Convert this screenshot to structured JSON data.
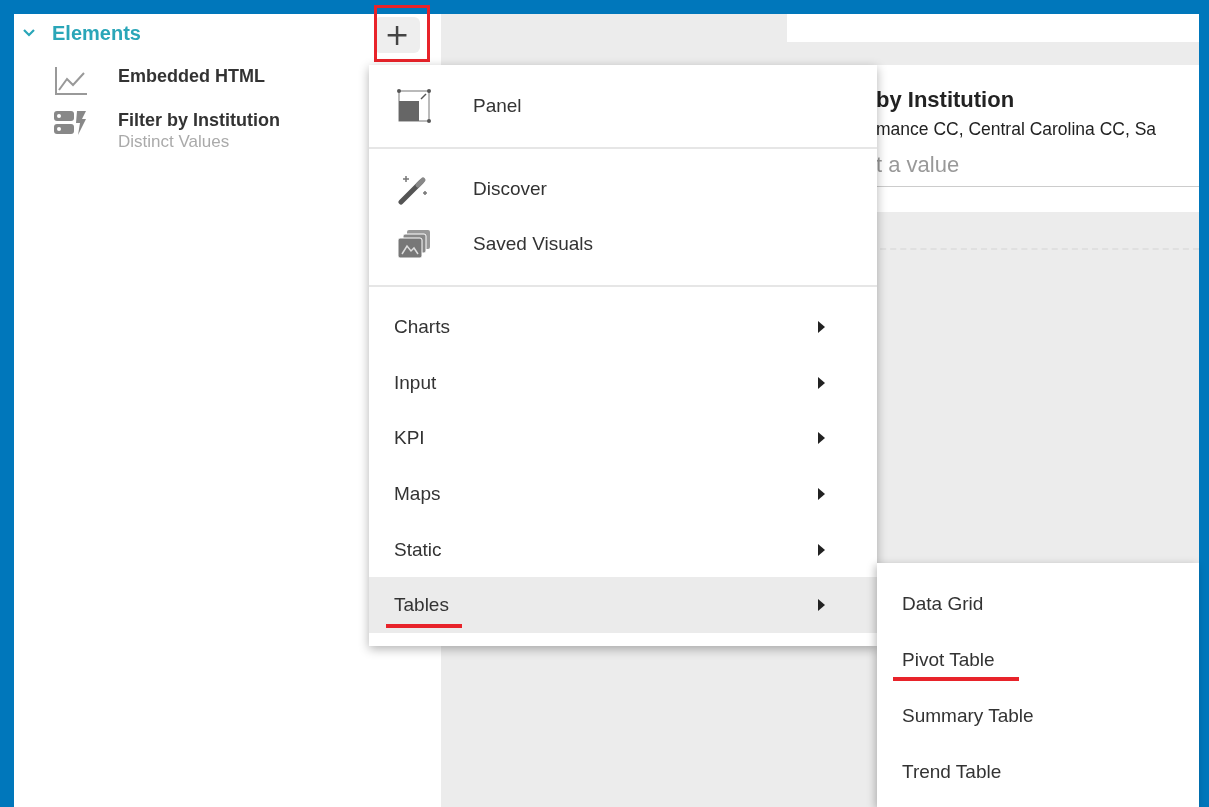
{
  "sidebar": {
    "title": "Elements",
    "expanded": true,
    "add_button": {
      "label": "+",
      "highlighted": true
    },
    "items": [
      {
        "kind": "chart",
        "title": "Embedded HTML"
      },
      {
        "kind": "filter",
        "title": "Filter by Institution",
        "subtitle": "Distinct Values"
      }
    ]
  },
  "canvas": {
    "filter_card": {
      "title": "by Institution",
      "values": "mance CC, Central Carolina CC, Sa",
      "placeholder": "t a value"
    }
  },
  "menu": {
    "sections": [
      [
        {
          "kind": "panel",
          "label": "Panel",
          "selected": false,
          "underlined": false
        }
      ],
      [
        {
          "kind": "wand",
          "label": "Discover",
          "selected": false,
          "underlined": false
        },
        {
          "kind": "images",
          "label": "Saved Visuals",
          "selected": false,
          "underlined": false
        }
      ],
      [
        {
          "kind": "submenu",
          "label": "Charts",
          "selected": false,
          "underlined": false
        },
        {
          "kind": "submenu",
          "label": "Input",
          "selected": false,
          "underlined": false
        },
        {
          "kind": "submenu",
          "label": "KPI",
          "selected": false,
          "underlined": false
        },
        {
          "kind": "submenu",
          "label": "Maps",
          "selected": false,
          "underlined": false
        },
        {
          "kind": "submenu",
          "label": "Static",
          "selected": false,
          "underlined": false
        },
        {
          "kind": "submenu",
          "label": "Tables",
          "selected": true,
          "underlined": true
        }
      ]
    ]
  },
  "submenu": {
    "items": [
      {
        "label": "Data Grid",
        "underlined": false
      },
      {
        "label": "Pivot Table",
        "underlined": true
      },
      {
        "label": "Summary Table",
        "underlined": false
      },
      {
        "label": "Trend Table",
        "underlined": false
      }
    ]
  }
}
